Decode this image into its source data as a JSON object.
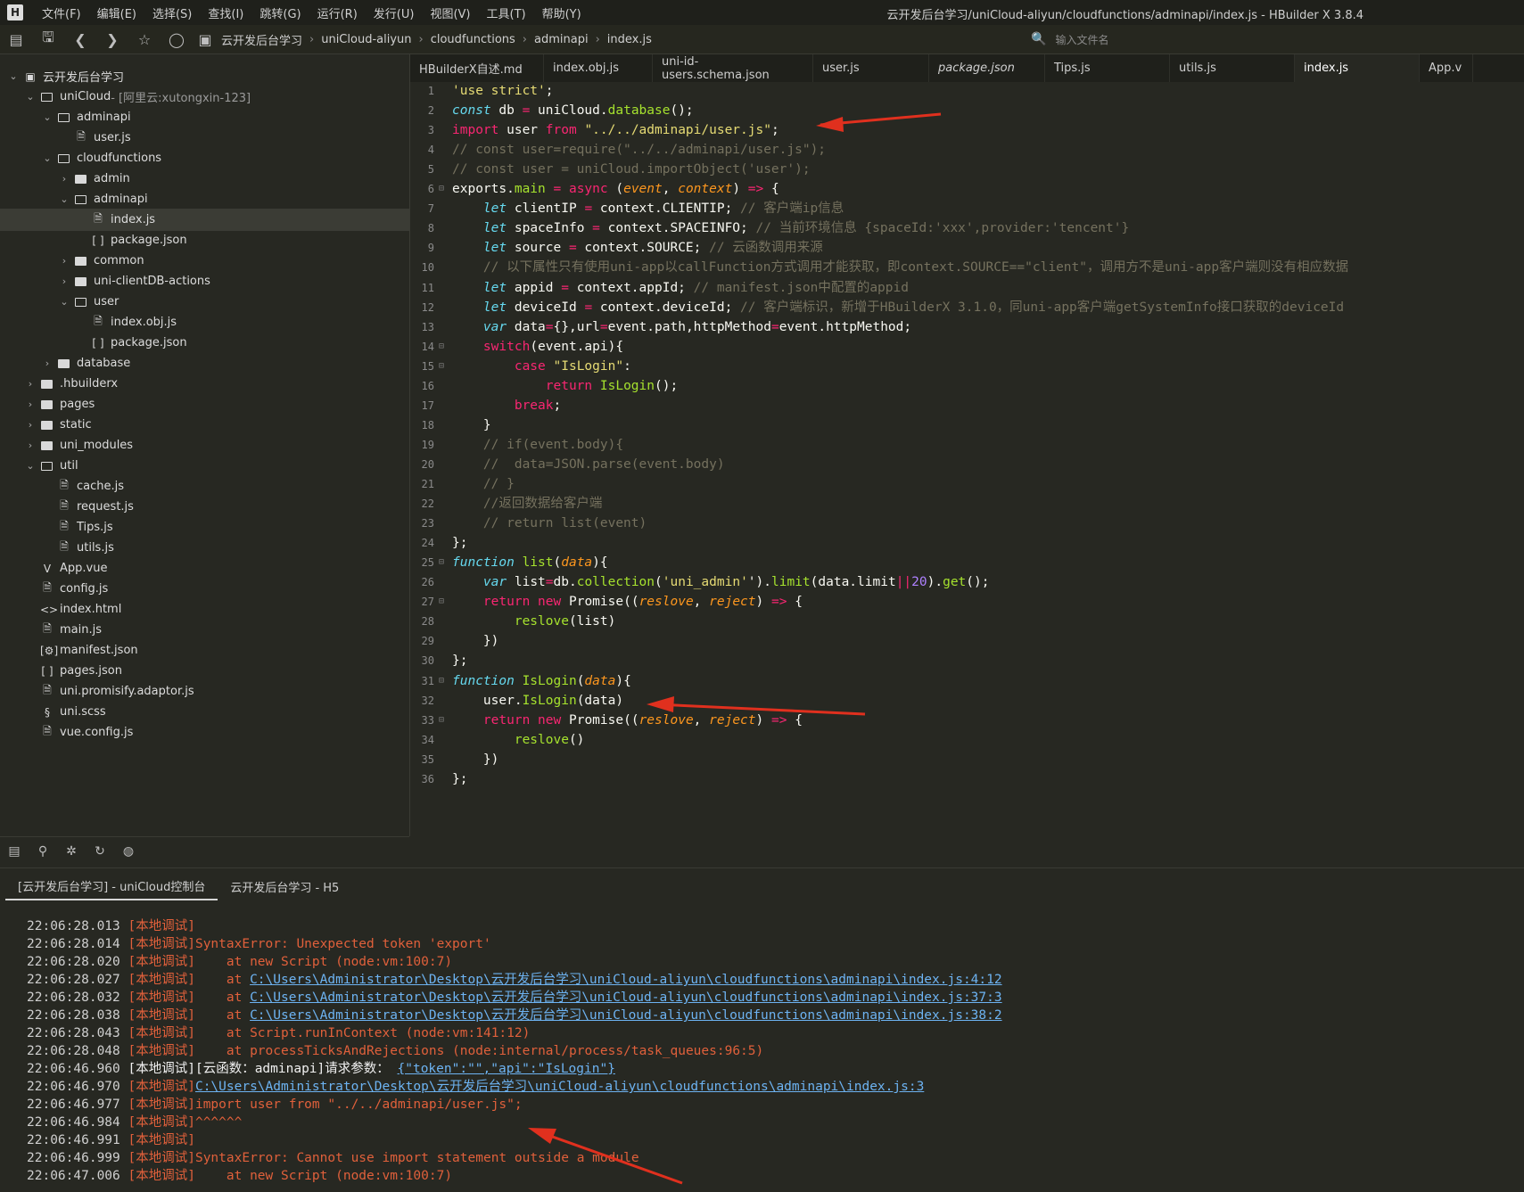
{
  "app": {
    "logo": "H",
    "window_title": "云开发后台学习/uniCloud-aliyun/cloudfunctions/adminapi/index.js - HBuilder X 3.8.4"
  },
  "menu": [
    "文件(F)",
    "编辑(E)",
    "选择(S)",
    "查找(I)",
    "跳转(G)",
    "运行(R)",
    "发行(U)",
    "视图(V)",
    "工具(T)",
    "帮助(Y)"
  ],
  "toolbar": {
    "breadcrumb": [
      "云开发后台学习",
      "uniCloud-aliyun",
      "cloudfunctions",
      "adminapi",
      "index.js"
    ],
    "file_search_placeholder": "输入文件名"
  },
  "tree": [
    {
      "depth": 0,
      "type": "root",
      "open": true,
      "label": "云开发后台学习"
    },
    {
      "depth": 1,
      "type": "folder",
      "open": true,
      "label": "uniCloud",
      "suffix": " - [阿里云:xutongxin-123]"
    },
    {
      "depth": 2,
      "type": "folder",
      "open": true,
      "label": "adminapi"
    },
    {
      "depth": 3,
      "type": "js",
      "label": "user.js"
    },
    {
      "depth": 2,
      "type": "folder",
      "open": true,
      "label": "cloudfunctions"
    },
    {
      "depth": 3,
      "type": "folder",
      "open": false,
      "label": "admin"
    },
    {
      "depth": 3,
      "type": "folder",
      "open": true,
      "label": "adminapi"
    },
    {
      "depth": 4,
      "type": "js",
      "label": "index.js",
      "selected": true
    },
    {
      "depth": 4,
      "type": "json",
      "label": "package.json"
    },
    {
      "depth": 3,
      "type": "folder",
      "open": false,
      "label": "common"
    },
    {
      "depth": 3,
      "type": "folder",
      "open": false,
      "label": "uni-clientDB-actions"
    },
    {
      "depth": 3,
      "type": "folder",
      "open": true,
      "label": "user"
    },
    {
      "depth": 4,
      "type": "js",
      "label": "index.obj.js"
    },
    {
      "depth": 4,
      "type": "json",
      "label": "package.json"
    },
    {
      "depth": 2,
      "type": "folder",
      "open": false,
      "label": "database"
    },
    {
      "depth": 1,
      "type": "folder",
      "open": false,
      "label": ".hbuilderx"
    },
    {
      "depth": 1,
      "type": "folder",
      "open": false,
      "label": "pages"
    },
    {
      "depth": 1,
      "type": "folder",
      "open": false,
      "label": "static"
    },
    {
      "depth": 1,
      "type": "folder",
      "open": false,
      "label": "uni_modules"
    },
    {
      "depth": 1,
      "type": "folder",
      "open": true,
      "label": "util"
    },
    {
      "depth": 2,
      "type": "js",
      "label": "cache.js"
    },
    {
      "depth": 2,
      "type": "js",
      "label": "request.js"
    },
    {
      "depth": 2,
      "type": "js",
      "label": "Tips.js"
    },
    {
      "depth": 2,
      "type": "js",
      "label": "utils.js"
    },
    {
      "depth": 1,
      "type": "vue",
      "label": "App.vue"
    },
    {
      "depth": 1,
      "type": "js",
      "label": "config.js"
    },
    {
      "depth": 1,
      "type": "html",
      "label": "index.html"
    },
    {
      "depth": 1,
      "type": "js",
      "label": "main.js"
    },
    {
      "depth": 1,
      "type": "manifest",
      "label": "manifest.json"
    },
    {
      "depth": 1,
      "type": "json",
      "label": "pages.json"
    },
    {
      "depth": 1,
      "type": "js",
      "label": "uni.promisify.adaptor.js"
    },
    {
      "depth": 1,
      "type": "scss",
      "label": "uni.scss"
    },
    {
      "depth": 1,
      "type": "js",
      "label": "vue.config.js"
    }
  ],
  "sidebar_bottom_icons": [
    "project-manager-icon",
    "plugin-icon",
    "debug-icon",
    "git-icon",
    "extension-icon"
  ],
  "tabs": [
    {
      "label": "HBuilderX自述.md"
    },
    {
      "label": "index.obj.js"
    },
    {
      "label": "uni-id-users.schema.json"
    },
    {
      "label": "user.js"
    },
    {
      "label": "package.json",
      "italic": true
    },
    {
      "label": "Tips.js"
    },
    {
      "label": "utils.js"
    },
    {
      "label": "index.js",
      "active": true
    },
    {
      "label": "App.v"
    }
  ],
  "code": [
    [
      [
        "s",
        "'use strict'"
      ],
      [
        "w",
        ";"
      ]
    ],
    [
      [
        "v",
        "const"
      ],
      [
        "w",
        " db "
      ],
      [
        "k",
        "="
      ],
      [
        "w",
        " uniCloud."
      ],
      [
        "f",
        "database"
      ],
      [
        "w",
        "();"
      ]
    ],
    [
      [
        "k",
        "import"
      ],
      [
        "w",
        " user "
      ],
      [
        "k",
        "from"
      ],
      [
        "w",
        " "
      ],
      [
        "s",
        "\"../../adminapi/user.js\""
      ],
      [
        "w",
        ";"
      ]
    ],
    [
      [
        "c",
        "// const user=require(\"../../adminapi/user.js\");"
      ]
    ],
    [
      [
        "c",
        "// const user = uniCloud.importObject('user');"
      ]
    ],
    [
      [
        "w",
        "exports."
      ],
      [
        "f",
        "main"
      ],
      [
        "w",
        " "
      ],
      [
        "k",
        "="
      ],
      [
        "w",
        " "
      ],
      [
        "k",
        "async"
      ],
      [
        "w",
        " ("
      ],
      [
        "p",
        "event"
      ],
      [
        "w",
        ", "
      ],
      [
        "p",
        "context"
      ],
      [
        "w",
        ") "
      ],
      [
        "k",
        "=>"
      ],
      [
        "w",
        " {"
      ]
    ],
    [
      [
        "w",
        "    "
      ],
      [
        "v",
        "let"
      ],
      [
        "w",
        " clientIP "
      ],
      [
        "k",
        "="
      ],
      [
        "w",
        " context.CLIENTIP; "
      ],
      [
        "c",
        "// 客户端ip信息"
      ]
    ],
    [
      [
        "w",
        "    "
      ],
      [
        "v",
        "let"
      ],
      [
        "w",
        " spaceInfo "
      ],
      [
        "k",
        "="
      ],
      [
        "w",
        " context.SPACEINFO; "
      ],
      [
        "c",
        "// 当前环境信息 {spaceId:'xxx',provider:'tencent'}"
      ]
    ],
    [
      [
        "w",
        "    "
      ],
      [
        "v",
        "let"
      ],
      [
        "w",
        " source "
      ],
      [
        "k",
        "="
      ],
      [
        "w",
        " context.SOURCE; "
      ],
      [
        "c",
        "// 云函数调用来源"
      ]
    ],
    [
      [
        "w",
        "    "
      ],
      [
        "c",
        "// 以下属性只有使用uni-app以callFunction方式调用才能获取，即context.SOURCE==\"client\"，调用方不是uni-app客户端则没有相应数据"
      ]
    ],
    [
      [
        "w",
        "    "
      ],
      [
        "v",
        "let"
      ],
      [
        "w",
        " appid "
      ],
      [
        "k",
        "="
      ],
      [
        "w",
        " context.appId; "
      ],
      [
        "c",
        "// manifest.json中配置的appid"
      ]
    ],
    [
      [
        "w",
        "    "
      ],
      [
        "v",
        "let"
      ],
      [
        "w",
        " deviceId "
      ],
      [
        "k",
        "="
      ],
      [
        "w",
        " context.deviceId; "
      ],
      [
        "c",
        "// 客户端标识，新增于HBuilderX 3.1.0，同uni-app客户端getSystemInfo接口获取的deviceId"
      ]
    ],
    [
      [
        "w",
        "    "
      ],
      [
        "v",
        "var"
      ],
      [
        "w",
        " data"
      ],
      [
        "k",
        "="
      ],
      [
        "w",
        "{},url"
      ],
      [
        "k",
        "="
      ],
      [
        "w",
        "event.path,httpMethod"
      ],
      [
        "k",
        "="
      ],
      [
        "w",
        "event.httpMethod;"
      ]
    ],
    [
      [
        "w",
        "    "
      ],
      [
        "k",
        "switch"
      ],
      [
        "w",
        "(event.api){"
      ]
    ],
    [
      [
        "w",
        "        "
      ],
      [
        "k",
        "case"
      ],
      [
        "w",
        " "
      ],
      [
        "s",
        "\"IsLogin\""
      ],
      [
        "w",
        ":"
      ]
    ],
    [
      [
        "w",
        "            "
      ],
      [
        "k",
        "return"
      ],
      [
        "w",
        " "
      ],
      [
        "f",
        "IsLogin"
      ],
      [
        "w",
        "();"
      ]
    ],
    [
      [
        "w",
        "        "
      ],
      [
        "k",
        "break"
      ],
      [
        "w",
        ";"
      ]
    ],
    [
      [
        "w",
        "    }"
      ]
    ],
    [
      [
        "w",
        "    "
      ],
      [
        "c",
        "// if(event.body){"
      ]
    ],
    [
      [
        "w",
        "    "
      ],
      [
        "c",
        "//  data=JSON.parse(event.body)"
      ]
    ],
    [
      [
        "w",
        "    "
      ],
      [
        "c",
        "// }"
      ]
    ],
    [
      [
        "w",
        "    "
      ],
      [
        "c",
        "//返回数据给客户端"
      ]
    ],
    [
      [
        "w",
        "    "
      ],
      [
        "c",
        "// return list(event)"
      ]
    ],
    [
      [
        "w",
        "};"
      ]
    ],
    [
      [
        "v",
        "function"
      ],
      [
        "w",
        " "
      ],
      [
        "f",
        "list"
      ],
      [
        "w",
        "("
      ],
      [
        "p",
        "data"
      ],
      [
        "w",
        "){"
      ]
    ],
    [
      [
        "w",
        "    "
      ],
      [
        "v",
        "var"
      ],
      [
        "w",
        " list"
      ],
      [
        "k",
        "="
      ],
      [
        "w",
        "db."
      ],
      [
        "f",
        "collection"
      ],
      [
        "w",
        "("
      ],
      [
        "s",
        "'uni_admin'"
      ],
      [
        "w",
        "')."
      ],
      [
        "f",
        "limit"
      ],
      [
        "w",
        "(data.limit"
      ],
      [
        "k",
        "||"
      ],
      [
        "n",
        "20"
      ],
      [
        "w",
        ")."
      ],
      [
        "f",
        "get"
      ],
      [
        "w",
        "();"
      ]
    ],
    [
      [
        "w",
        "    "
      ],
      [
        "k",
        "return"
      ],
      [
        "w",
        " "
      ],
      [
        "k",
        "new"
      ],
      [
        "w",
        " Promise(("
      ],
      [
        "p",
        "reslove"
      ],
      [
        "w",
        ", "
      ],
      [
        "p",
        "reject"
      ],
      [
        "w",
        ") "
      ],
      [
        "k",
        "=>"
      ],
      [
        "w",
        " {"
      ]
    ],
    [
      [
        "w",
        "        "
      ],
      [
        "f",
        "reslove"
      ],
      [
        "w",
        "(list)"
      ]
    ],
    [
      [
        "w",
        "    })"
      ]
    ],
    [
      [
        "w",
        "};"
      ]
    ],
    [
      [
        "v",
        "function"
      ],
      [
        "w",
        " "
      ],
      [
        "f",
        "IsLogin"
      ],
      [
        "w",
        "("
      ],
      [
        "p",
        "data"
      ],
      [
        "w",
        "){"
      ]
    ],
    [
      [
        "w",
        "    user."
      ],
      [
        "f",
        "IsLogin"
      ],
      [
        "w",
        "(data)"
      ]
    ],
    [
      [
        "w",
        "    "
      ],
      [
        "k",
        "return"
      ],
      [
        "w",
        " "
      ],
      [
        "k",
        "new"
      ],
      [
        "w",
        " Promise(("
      ],
      [
        "p",
        "reslove"
      ],
      [
        "w",
        ", "
      ],
      [
        "p",
        "reject"
      ],
      [
        "w",
        ") "
      ],
      [
        "k",
        "=>"
      ],
      [
        "w",
        " {"
      ]
    ],
    [
      [
        "w",
        "        "
      ],
      [
        "f",
        "reslove"
      ],
      [
        "w",
        "()"
      ]
    ],
    [
      [
        "w",
        "    })"
      ]
    ],
    [
      [
        "w",
        "};"
      ]
    ]
  ],
  "fold_lines": [
    6,
    14,
    15,
    25,
    27,
    31,
    33
  ],
  "console": {
    "tabs": [
      {
        "label": "[云开发后台学习] - uniCloud控制台",
        "active": true
      },
      {
        "label": "云开发后台学习 - H5"
      }
    ],
    "lines": [
      {
        "time": "22:06:28.013",
        "tag": "[本地调试]",
        "parts": []
      },
      {
        "time": "22:06:28.014",
        "tag": "[本地调试]",
        "parts": [
          [
            "err",
            "SyntaxError: Unexpected token 'export'"
          ]
        ]
      },
      {
        "time": "22:06:28.020",
        "tag": "[本地调试]",
        "parts": [
          [
            "err",
            "    at new Script (node:vm:100:7)"
          ]
        ]
      },
      {
        "time": "22:06:28.027",
        "tag": "[本地调试]",
        "parts": [
          [
            "err",
            "    at "
          ],
          [
            "link",
            "C:\\Users\\Administrator\\Desktop\\云开发后台学习\\uniCloud-aliyun\\cloudfunctions\\adminapi\\index.js:4:12"
          ]
        ]
      },
      {
        "time": "22:06:28.032",
        "tag": "[本地调试]",
        "parts": [
          [
            "err",
            "    at "
          ],
          [
            "link",
            "C:\\Users\\Administrator\\Desktop\\云开发后台学习\\uniCloud-aliyun\\cloudfunctions\\adminapi\\index.js:37:3"
          ]
        ]
      },
      {
        "time": "22:06:28.038",
        "tag": "[本地调试]",
        "parts": [
          [
            "err",
            "    at "
          ],
          [
            "link",
            "C:\\Users\\Administrator\\Desktop\\云开发后台学习\\uniCloud-aliyun\\cloudfunctions\\adminapi\\index.js:38:2"
          ]
        ]
      },
      {
        "time": "22:06:28.043",
        "tag": "[本地调试]",
        "parts": [
          [
            "err",
            "    at Script.runInContext (node:vm:141:12)"
          ]
        ]
      },
      {
        "time": "22:06:28.048",
        "tag": "[本地调试]",
        "parts": [
          [
            "err",
            "    at processTicksAndRejections (node:internal/process/task_queues:96:5)"
          ]
        ]
      },
      {
        "time": "22:06:46.960",
        "tag": "[本地调试]",
        "tag_white": true,
        "parts": [
          [
            "white",
            "[云函数：adminapi]请求参数： "
          ],
          [
            "link",
            "{\"token\":\"\",\"api\":\"IsLogin\"}"
          ]
        ]
      },
      {
        "time": "22:06:46.970",
        "tag": "[本地调试]",
        "parts": [
          [
            "link",
            "C:\\Users\\Administrator\\Desktop\\云开发后台学习\\uniCloud-aliyun\\cloudfunctions\\adminapi\\index.js:3"
          ]
        ]
      },
      {
        "time": "22:06:46.977",
        "tag": "[本地调试]",
        "parts": [
          [
            "err",
            "import user from \"../../adminapi/user.js\";"
          ]
        ]
      },
      {
        "time": "22:06:46.984",
        "tag": "[本地调试]",
        "parts": [
          [
            "err",
            "^^^^^^"
          ]
        ]
      },
      {
        "time": "22:06:46.991",
        "tag": "[本地调试]",
        "parts": []
      },
      {
        "time": "22:06:46.999",
        "tag": "[本地调试]",
        "parts": [
          [
            "err",
            "SyntaxError: Cannot use import statement outside a module"
          ]
        ]
      },
      {
        "time": "22:06:47.006",
        "tag": "[本地调试]",
        "parts": [
          [
            "err",
            "    at new Script (node:vm:100:7)"
          ]
        ]
      }
    ]
  },
  "colors": {
    "background": "#272822",
    "annotation_arrow": "#e0301e",
    "console_error": "#e0603b",
    "console_link": "#6db3f2"
  }
}
